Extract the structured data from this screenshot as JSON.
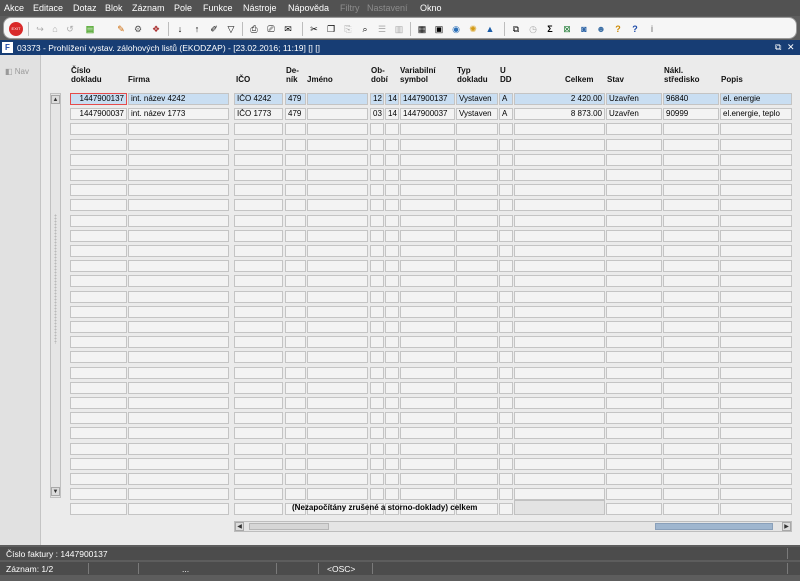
{
  "menu": [
    "Akce",
    "Editace",
    "Dotaz",
    "Blok",
    "Záznam",
    "Pole",
    "Funkce",
    "Nástroje",
    "Nápověda",
    "Filtry",
    "Nastavení",
    "Okno"
  ],
  "window_title": "03373 - Prohlížení vystav. zálohových listů (EKODZAP) - [23.02.2016; 11:19] [] []",
  "window_controls": [
    "⧉",
    "✕"
  ],
  "nav_label": "Nav",
  "columns": [
    {
      "key": "cislo",
      "label": "Číslo dokladu"
    },
    {
      "key": "firma",
      "label": "Firma"
    },
    {
      "key": "ico",
      "label": "IČO"
    },
    {
      "key": "denik",
      "label": "De- ník"
    },
    {
      "key": "jmeno",
      "label": "Jméno"
    },
    {
      "key": "obdobi",
      "label": "Ob- dobí"
    },
    {
      "key": "var",
      "label": "Variabilní symbol"
    },
    {
      "key": "typ",
      "label": "Typ dokladu"
    },
    {
      "key": "udd",
      "label": "U DD"
    },
    {
      "key": "celkem",
      "label": "Celkem"
    },
    {
      "key": "stav",
      "label": "Stav"
    },
    {
      "key": "nakl",
      "label": "Nákl. středisko"
    },
    {
      "key": "popis",
      "label": "Popis"
    }
  ],
  "rows": [
    {
      "cislo": "1447900137",
      "firma": "int. název 4242",
      "ico": "IČO 4242",
      "denik": "479",
      "jmeno": "",
      "obd1": "12",
      "obd2": "14",
      "var": "1447900137",
      "typ": "Vystaven",
      "udd": "A",
      "celkem": "2 420.00",
      "stav": "Uzavřen",
      "nakl": "96840",
      "popis": "el. energie"
    },
    {
      "cislo": "1447900037",
      "firma": "int. název 1773",
      "ico": "IČO 1773",
      "denik": "479",
      "jmeno": "",
      "obd1": "03",
      "obd2": "14",
      "var": "1447900037",
      "typ": "Vystaven",
      "udd": "A",
      "celkem": "8 873.00",
      "stav": "Uzavřen",
      "nakl": "90999",
      "popis": "el.energie, teplo"
    }
  ],
  "empty_rows": 26,
  "total_label": "(Nezapočítány zrušené a storno-doklady) celkem",
  "total_value": "",
  "status_line1": "Číslo faktury : 1447900137",
  "status_line2": {
    "zaznam": "Záznam: 1/2",
    "dots": "...",
    "mode": "<OSC>"
  },
  "colors": {
    "titlebar": "#173d74",
    "selected_row": "#c9def2",
    "focus_border": "#e54b4b",
    "menubar": "#525252"
  }
}
